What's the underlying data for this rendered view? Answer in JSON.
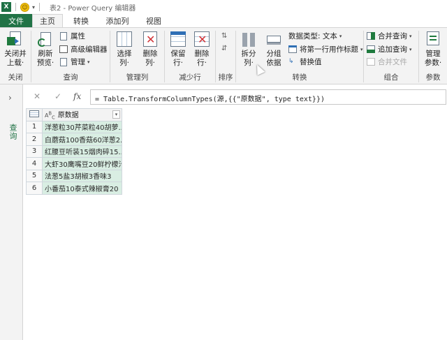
{
  "titlebar": {
    "excel_badge": "X",
    "smiley": "☺",
    "caret": "▾",
    "title": "表2 - Power Query 编辑器"
  },
  "tabs": {
    "file": "文件",
    "home": "主页",
    "transform": "转换",
    "addcol": "添加列",
    "view": "视图"
  },
  "ribbon": {
    "close": {
      "btn": "关闭并\n上载",
      "label": "关闭",
      "btn_line1": "关闭并",
      "btn_line2": "上载·"
    },
    "query": {
      "refresh_line1": "刷新",
      "refresh_line2": "预览·",
      "properties": "属性",
      "advanced_editor": "高级编辑器",
      "manage": "管理",
      "label": "查询"
    },
    "manage_cols": {
      "choose_line1": "选择",
      "choose_line2": "列·",
      "remove_line1": "删除",
      "remove_line2": "列·",
      "label": "管理列"
    },
    "reduce_rows": {
      "keep_line1": "保留",
      "keep_line2": "行·",
      "remove_line1": "删除",
      "remove_line2": "行·",
      "label": "减少行"
    },
    "sort": {
      "label": "排序"
    },
    "transform": {
      "split_line1": "拆分",
      "split_line2": "列·",
      "group_line1": "分组",
      "group_line2": "依据",
      "datatype": "数据类型: 文本",
      "first_row_header": "将第一行用作标题",
      "replace_values": "替换值",
      "label": "转换"
    },
    "combine": {
      "merge_queries": "合并查询",
      "append_queries": "追加查询",
      "combine_files": "合并文件",
      "label": "组合"
    },
    "params": {
      "manage_line1": "管理",
      "manage_line2": "参数·",
      "label": "参数"
    }
  },
  "formula": {
    "cancel": "✕",
    "confirm": "✓",
    "fx": "fx",
    "text": "= Table.TransformColumnTypes(源,{{\"原数据\", type text}})"
  },
  "querypane": {
    "toggle": "›",
    "label": "查询"
  },
  "grid": {
    "type_icon": "A^B_C",
    "column_header": "原数据",
    "rows": [
      {
        "n": "1",
        "v": "洋葱粒30芹菜粒40胡萝..."
      },
      {
        "n": "2",
        "v": "白蘑菇100香菇60洋葱2..."
      },
      {
        "n": "3",
        "v": "红腰豆听装15烟肉碎15..."
      },
      {
        "n": "4",
        "v": "大虾30鹰嘴豆20鲜柠檬汁10"
      },
      {
        "n": "5",
        "v": "法葱5盐3胡椒3香味3"
      },
      {
        "n": "6",
        "v": "小番茄10泰式辣椒膏20"
      }
    ]
  }
}
